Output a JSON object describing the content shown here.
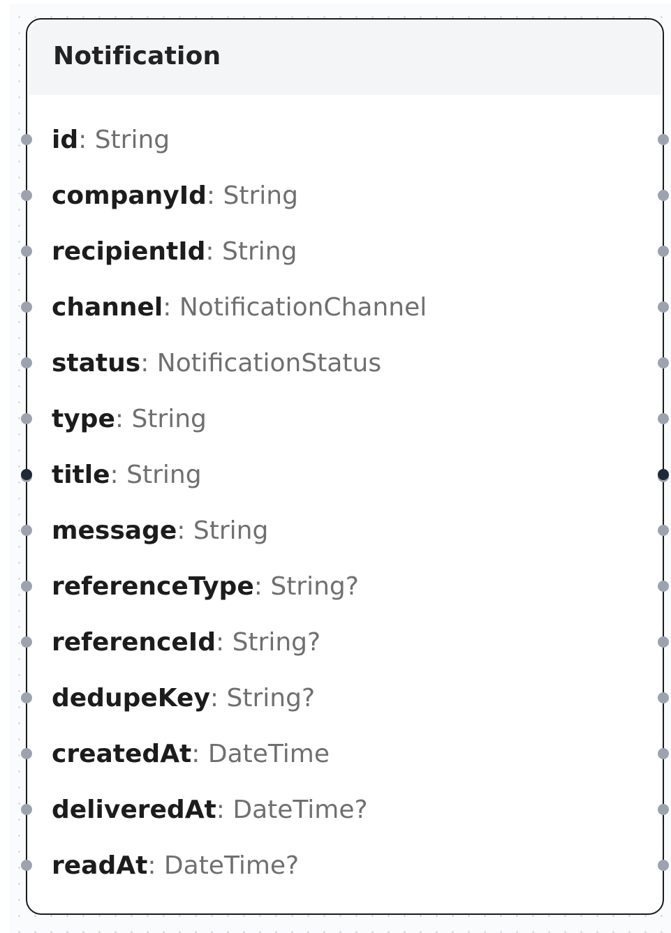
{
  "node": {
    "title": "Notification",
    "fields": [
      {
        "name": "id",
        "type": "String"
      },
      {
        "name": "companyId",
        "type": "String"
      },
      {
        "name": "recipientId",
        "type": "String"
      },
      {
        "name": "channel",
        "type": "NotificationChannel"
      },
      {
        "name": "status",
        "type": "NotificationStatus"
      },
      {
        "name": "type",
        "type": "String"
      },
      {
        "name": "title",
        "type": "String"
      },
      {
        "name": "message",
        "type": "String"
      },
      {
        "name": "referenceType",
        "type": "String?"
      },
      {
        "name": "referenceId",
        "type": "String?"
      },
      {
        "name": "dedupeKey",
        "type": "String?"
      },
      {
        "name": "createdAt",
        "type": "DateTime"
      },
      {
        "name": "deliveredAt",
        "type": "DateTime?"
      },
      {
        "name": "readAt",
        "type": "DateTime?"
      }
    ],
    "separator": ":"
  },
  "colors": {
    "border": "#1a1a1a",
    "header_bg": "#f4f5f6",
    "handle": "#9ca3af",
    "handle_active": "#1f2937"
  }
}
